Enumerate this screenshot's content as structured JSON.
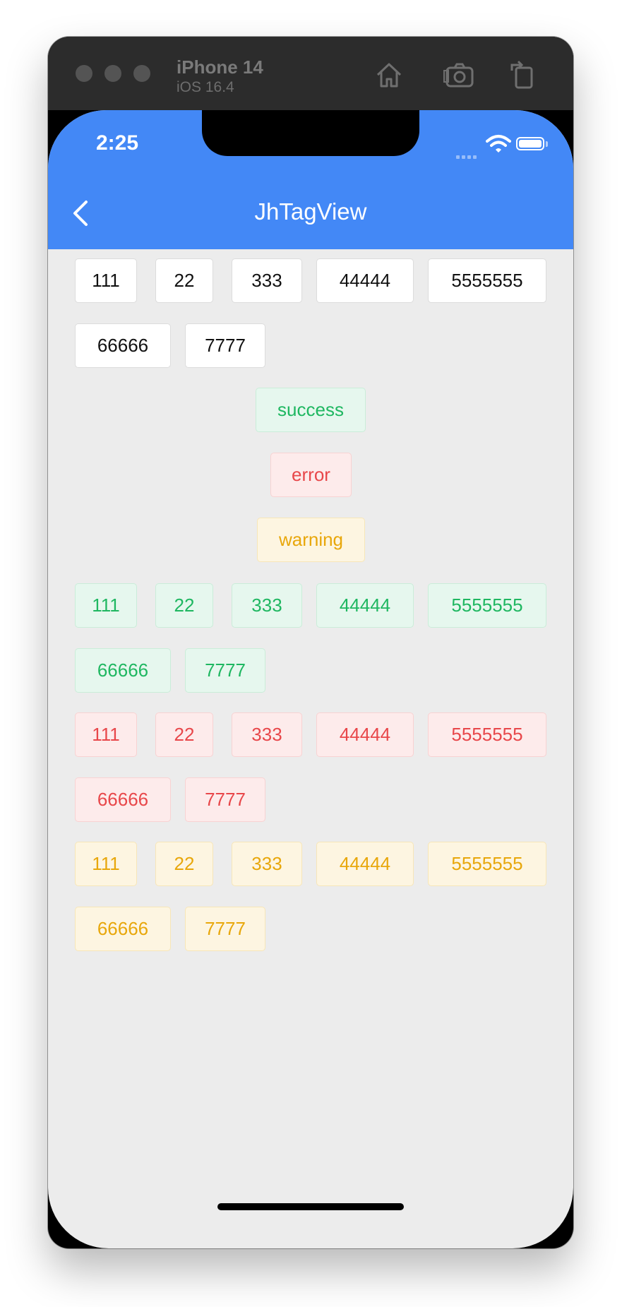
{
  "simulator": {
    "device": "iPhone 14",
    "os": "iOS 16.4"
  },
  "status_bar": {
    "time": "2:25"
  },
  "nav": {
    "title": "JhTagView"
  },
  "tags": {
    "default_row": [
      "111",
      "22",
      "333",
      "44444",
      "5555555",
      "66666",
      "7777"
    ],
    "single": {
      "success": "success",
      "error": "error",
      "warning": "warning"
    },
    "success_row": [
      "111",
      "22",
      "333",
      "44444",
      "5555555",
      "66666",
      "7777"
    ],
    "error_row": [
      "111",
      "22",
      "333",
      "44444",
      "5555555",
      "66666",
      "7777"
    ],
    "warning_row": [
      "111",
      "22",
      "333",
      "44444",
      "5555555",
      "66666",
      "7777"
    ]
  },
  "colors": {
    "nav_bar": "#4388f6",
    "success": "#1fb761",
    "error": "#e8474a",
    "warning": "#e8a70b"
  }
}
